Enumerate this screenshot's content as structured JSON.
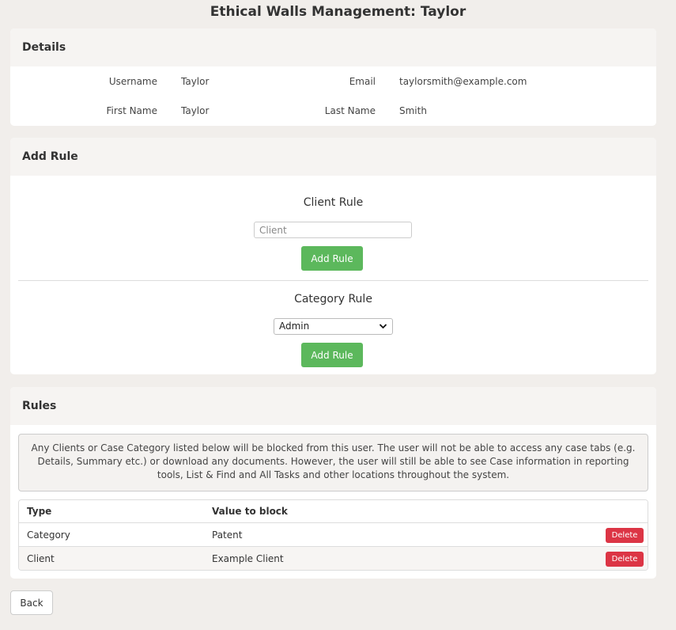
{
  "page": {
    "title": "Ethical Walls Management: Taylor"
  },
  "details": {
    "heading": "Details",
    "username_label": "Username",
    "username": "Taylor",
    "email_label": "Email",
    "email": "taylorsmith@example.com",
    "first_name_label": "First Name",
    "first_name": "Taylor",
    "last_name_label": "Last Name",
    "last_name": "Smith"
  },
  "add_rule": {
    "heading": "Add Rule",
    "client_rule_title": "Client Rule",
    "client_placeholder": "Client",
    "client_value": "",
    "client_button": "Add Rule",
    "category_rule_title": "Category Rule",
    "category_selected": "Admin",
    "category_button": "Add Rule"
  },
  "rules": {
    "heading": "Rules",
    "notice": "Any Clients or Case Category listed below will be blocked from this user. The user will not be able to access any case tabs (e.g. Details, Summary etc.) or download any documents. However, the user will still be able to see Case information in reporting tools, List & Find and All Tasks and other locations throughout the system.",
    "columns": {
      "type": "Type",
      "value": "Value to block"
    },
    "rows": [
      {
        "type": "Category",
        "value": "Patent",
        "action": "Delete"
      },
      {
        "type": "Client",
        "value": "Example Client",
        "action": "Delete"
      }
    ]
  },
  "footer": {
    "back_label": "Back"
  },
  "colors": {
    "background": "#f1eeeb",
    "primary_green": "#5cb85c",
    "danger_red": "#dc3545"
  },
  "icons": {
    "select_chevron": "chevron-down-icon"
  }
}
